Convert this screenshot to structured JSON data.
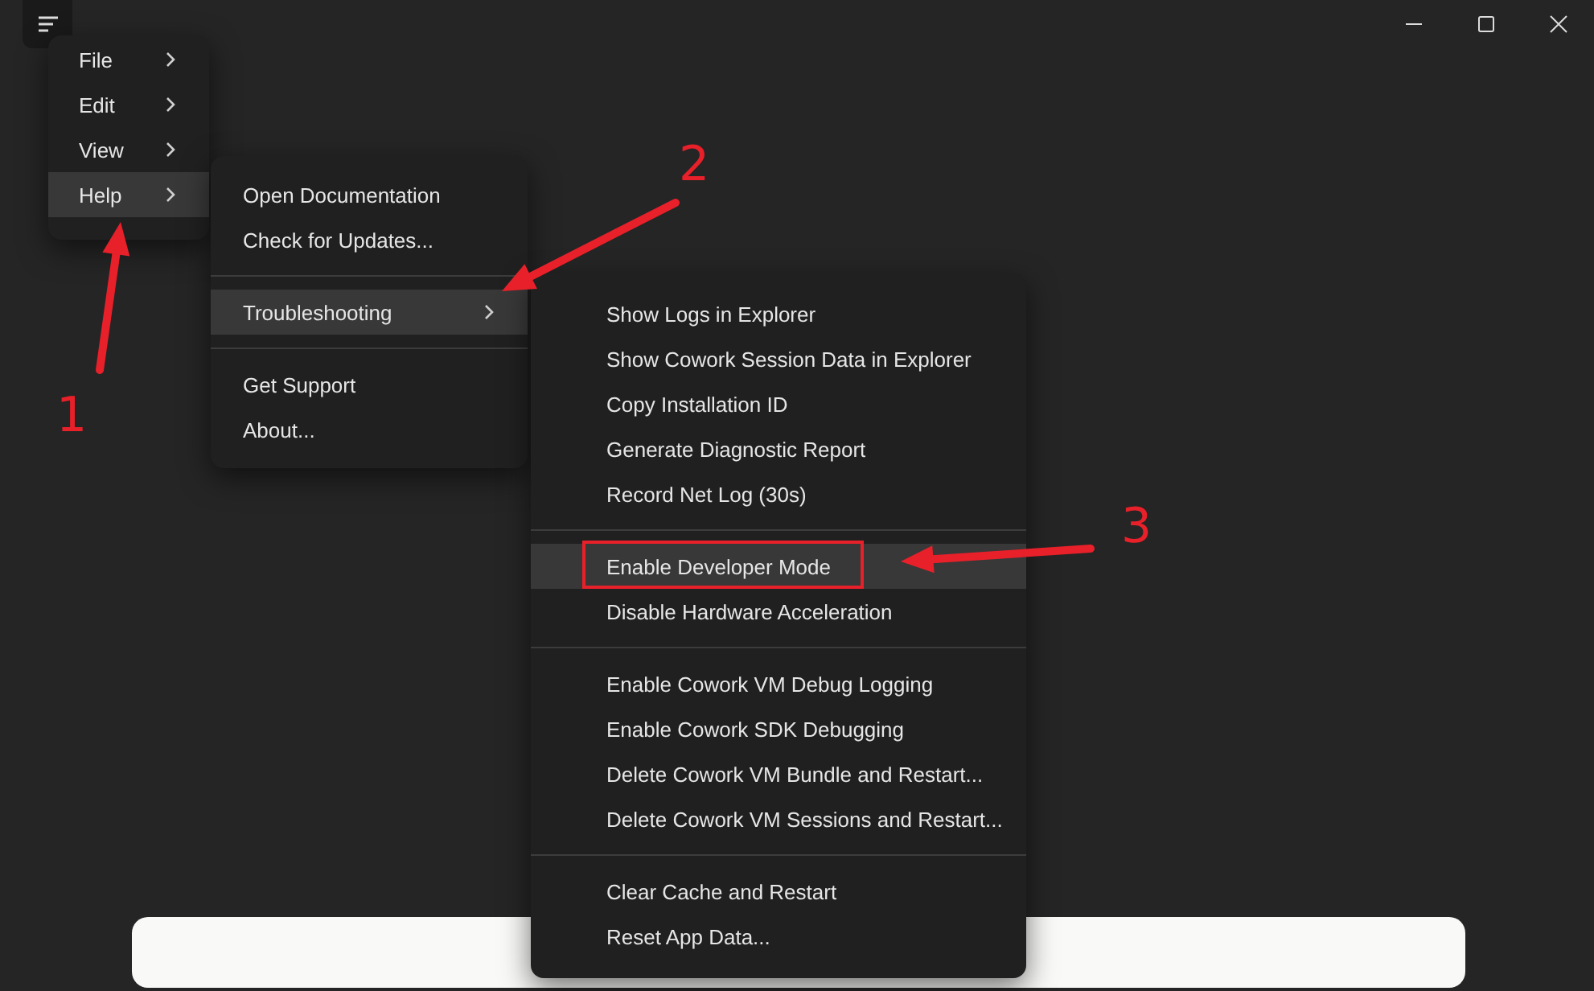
{
  "app_menu": {
    "sections": [
      [
        {
          "label": "File",
          "has_submenu": true,
          "selected": false
        },
        {
          "label": "Edit",
          "has_submenu": true,
          "selected": false
        },
        {
          "label": "View",
          "has_submenu": true,
          "selected": false
        },
        {
          "label": "Help",
          "has_submenu": true,
          "selected": true
        }
      ]
    ]
  },
  "help_menu": {
    "sections": [
      [
        {
          "label": "Open Documentation",
          "has_submenu": false,
          "selected": false
        },
        {
          "label": "Check for Updates...",
          "has_submenu": false,
          "selected": false
        }
      ],
      [
        {
          "label": "Troubleshooting",
          "has_submenu": true,
          "selected": true
        }
      ],
      [
        {
          "label": "Get Support",
          "has_submenu": false,
          "selected": false
        },
        {
          "label": "About...",
          "has_submenu": false,
          "selected": false
        }
      ]
    ]
  },
  "troubleshooting_menu": {
    "sections": [
      [
        {
          "label": "Show Logs in Explorer",
          "has_submenu": false,
          "selected": false,
          "outlined": false
        },
        {
          "label": "Show Cowork Session Data in Explorer",
          "has_submenu": false,
          "selected": false,
          "outlined": false
        },
        {
          "label": "Copy Installation ID",
          "has_submenu": false,
          "selected": false,
          "outlined": false
        },
        {
          "label": "Generate Diagnostic Report",
          "has_submenu": false,
          "selected": false,
          "outlined": false
        },
        {
          "label": "Record Net Log (30s)",
          "has_submenu": false,
          "selected": false,
          "outlined": false
        }
      ],
      [
        {
          "label": "Enable Developer Mode",
          "has_submenu": false,
          "selected": true,
          "outlined": true
        },
        {
          "label": "Disable Hardware Acceleration",
          "has_submenu": false,
          "selected": false,
          "outlined": false
        }
      ],
      [
        {
          "label": "Enable Cowork VM Debug Logging",
          "has_submenu": false,
          "selected": false,
          "outlined": false
        },
        {
          "label": "Enable Cowork SDK Debugging",
          "has_submenu": false,
          "selected": false,
          "outlined": false
        },
        {
          "label": "Delete Cowork VM Bundle and Restart...",
          "has_submenu": false,
          "selected": false,
          "outlined": false
        },
        {
          "label": "Delete Cowork VM Sessions and Restart...",
          "has_submenu": false,
          "selected": false,
          "outlined": false
        }
      ],
      [
        {
          "label": "Clear Cache and Restart",
          "has_submenu": false,
          "selected": false,
          "outlined": false
        },
        {
          "label": "Reset App Data...",
          "has_submenu": false,
          "selected": false,
          "outlined": false
        }
      ]
    ]
  },
  "annotations": [
    {
      "label": "1"
    },
    {
      "label": "2"
    },
    {
      "label": "3"
    }
  ]
}
